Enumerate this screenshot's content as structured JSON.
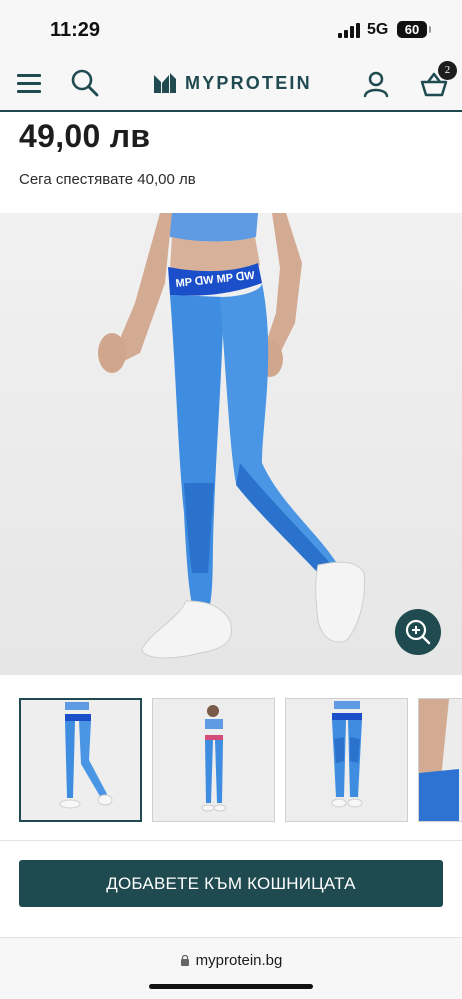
{
  "status_bar": {
    "time": "11:29",
    "network": "5G",
    "battery": "60"
  },
  "header": {
    "brand": "MYPROTEIN",
    "basket_count": "2",
    "icons": [
      "menu-icon",
      "search-icon",
      "account-icon",
      "basket-icon"
    ]
  },
  "product": {
    "price": "49,00 лв",
    "savings": "Сега спестявате 40,00 лв"
  },
  "gallery": {
    "thumbnail_count_visible": 4,
    "selected_index": 0
  },
  "actions": {
    "add_to_basket": "ДОБАВЕТЕ КЪМ КОШНИЦАТА"
  },
  "browser": {
    "url": "myprotein.bg"
  },
  "colors": {
    "brand_dark_teal": "#1f4a4f",
    "legging_blue": "#3f8de0",
    "waistband_blue": "#1a4fc9",
    "background_light": "#f7f7f7"
  }
}
